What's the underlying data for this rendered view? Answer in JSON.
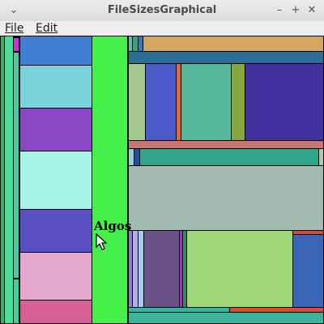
{
  "window": {
    "title": "FileSizesGraphical"
  },
  "controls": {
    "minimize": "–",
    "maximize": "+",
    "close": "✕"
  },
  "menubar": {
    "file": "File",
    "edit": "Edit"
  },
  "treemap": {
    "highlighted_label": "Algos"
  },
  "colors": {
    "highlight": "#46f04a",
    "blue": "#3f7fcf",
    "teal": "#7dd3db",
    "purple": "#8a48c3",
    "mint": "#a6f4e8",
    "indigo": "#5b4fc6",
    "pink": "#e7a8d0",
    "rose": "#d65f93"
  }
}
